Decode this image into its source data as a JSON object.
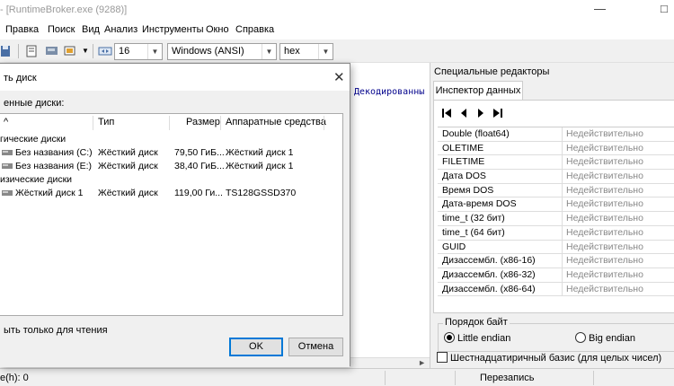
{
  "window": {
    "title": "- [RuntimeBroker.exe (9288)]"
  },
  "menu": [
    "Правка",
    "Поиск",
    "Вид",
    "Анализ",
    "Инструменты",
    "Окно",
    "Справка"
  ],
  "toolbar": {
    "bytes_per_row": "16",
    "encoding": "Windows (ANSI)",
    "number_format": "hex"
  },
  "editor": {
    "decoded_header": "Декодированны"
  },
  "right_panel": {
    "title": "Специальные редакторы",
    "tab": "Инспектор данных",
    "rows": [
      {
        "key": "Double (float64)",
        "value": "Недействительно"
      },
      {
        "key": "OLETIME",
        "value": "Недействительно"
      },
      {
        "key": "FILETIME",
        "value": "Недействительно"
      },
      {
        "key": "Дата DOS",
        "value": "Недействительно"
      },
      {
        "key": "Время DOS",
        "value": "Недействительно"
      },
      {
        "key": "Дата-время DOS",
        "value": "Недействительно"
      },
      {
        "key": "time_t (32 бит)",
        "value": "Недействительно"
      },
      {
        "key": "time_t (64 бит)",
        "value": "Недействительно"
      },
      {
        "key": "GUID",
        "value": "Недействительно"
      },
      {
        "key": "Дизассембл. (x86-16)",
        "value": "Недействительно"
      },
      {
        "key": "Дизассембл. (x86-32)",
        "value": "Недействительно"
      },
      {
        "key": "Дизассембл. (x86-64)",
        "value": "Недействительно"
      }
    ],
    "byte_order_label": "Порядок байт",
    "little_endian": "Little endian",
    "big_endian": "Big endian",
    "hex_basis": "Шестнадцатиричный базис (для целых чисел)"
  },
  "status": {
    "left": "e(h): 0",
    "mode": "Перезапись"
  },
  "dialog": {
    "title": "ть диск",
    "close": "✕",
    "list_label": "енные диски:",
    "columns": {
      "name": "^",
      "type": "Тип",
      "size": "Размер",
      "hw": "Аппаратные средства"
    },
    "group_logical": "гические диски",
    "group_physical": "изические диски",
    "rows": [
      {
        "name": "Без названия (C:)",
        "type": "Жёсткий диск",
        "size": "79,50 ГиБ...",
        "hw": "Жёсткий диск 1"
      },
      {
        "name": "Без названия (E:)",
        "type": "Жёсткий диск",
        "size": "38,40 ГиБ...",
        "hw": "Жёсткий диск 1"
      },
      {
        "name": "Жёсткий диск 1",
        "type": "Жёсткий диск",
        "size": "119,00 Ги...",
        "hw": "TS128GSSD370"
      }
    ],
    "readonly_label": "ыть только для чтения",
    "ok": "OK",
    "cancel": "Отмена"
  }
}
